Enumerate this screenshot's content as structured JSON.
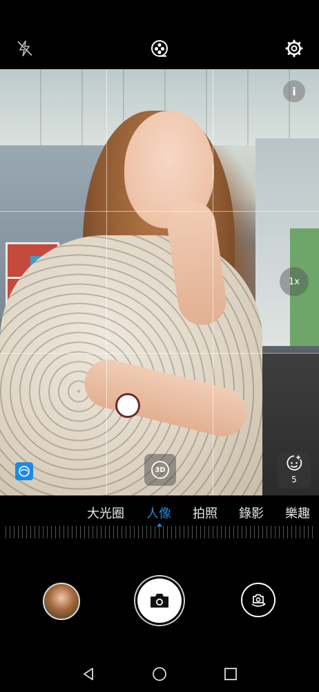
{
  "top_bar": {
    "flash_icon": "flash-off-icon",
    "filter_icon": "filter-icon",
    "settings_icon": "gear-icon"
  },
  "viewfinder": {
    "info_label": "i",
    "zoom_label": "1x",
    "btn_3d_label": "3D",
    "beauty_level": "5"
  },
  "modes": {
    "items": [
      "大光圈",
      "人像",
      "拍照",
      "錄影",
      "樂趣"
    ],
    "active": "人像"
  },
  "bottom": {
    "gallery_thumbnail_icon": "gallery-thumbnail",
    "shutter_icon": "camera-icon",
    "switch_camera_icon": "switch-camera-icon"
  },
  "nav": {
    "back_icon": "back-triangle-icon",
    "home_icon": "home-circle-icon",
    "recents_icon": "recents-square-icon"
  },
  "colors": {
    "accent": "#1e8be0",
    "background": "#000000"
  }
}
